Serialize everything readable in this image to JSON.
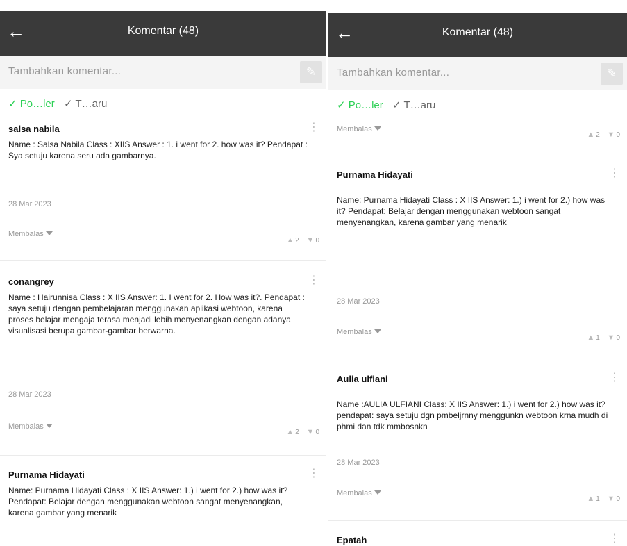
{
  "left": {
    "header": {
      "title": "Komentar (48)"
    },
    "input": {
      "placeholder": "Tambahkan komentar..."
    },
    "sort": {
      "popular": "✓ Po…ler",
      "newest": "✓ T…aru"
    },
    "comments": [
      {
        "author": "salsa nabila",
        "text": "Name : Salsa Nabila Class : XIIS Answer : 1. i went for 2. how was it? Pendapat : Sya setuju karena seru ada gambarnya.",
        "date": "28 Mar 2023",
        "reply": "Membalas",
        "likes": "2",
        "dislikes": "0"
      },
      {
        "author": "conangrey",
        "text": "Name : Hairunnisa Class : X IIS Answer: 1. I went for 2. How was it?. Pendapat : saya setuju dengan pembelajaran menggunakan aplikasi webtoon, karena proses belajar mengaja terasa menjadi lebih menyenangkan dengan adanya visualisasi berupa gambar-gambar berwarna.",
        "date": "28 Mar 2023",
        "reply": "Membalas",
        "likes": "2",
        "dislikes": "0"
      },
      {
        "author": "Purnama Hidayati",
        "text": "Name: Purnama Hidayati Class : X IIS Answer: 1.) i went for 2.) how was it? Pendapat: Belajar dengan menggunakan webtoon sangat menyenangkan, karena gambar yang menarik"
      }
    ]
  },
  "right": {
    "header": {
      "title": "Komentar (48)"
    },
    "input": {
      "placeholder": "Tambahkan komentar..."
    },
    "sort": {
      "popular": "✓ Po…ler",
      "newest": "✓ T…aru"
    },
    "partial": {
      "reply": "Membalas",
      "likes": "2",
      "dislikes": "0"
    },
    "comments": [
      {
        "author": "Purnama Hidayati",
        "text": "Name: Purnama Hidayati Class : X IIS Answer: 1.) i went for 2.) how was it? Pendapat: Belajar dengan menggunakan webtoon sangat menyenangkan, karena gambar yang menarik",
        "date": "28 Mar 2023",
        "reply": "Membalas",
        "likes": "1",
        "dislikes": "0"
      },
      {
        "author": "Aulia ulfiani",
        "text": "Name :AULIA ULFIANI Class: X IIS Answer: 1.) i went for 2.) how was it? pendapat: saya setuju dgn pmbeljrnny menggunkn webtoon krna mudh di phmi dan tdk mmbosnkn",
        "date": "28 Mar 2023",
        "reply": "Membalas",
        "likes": "1",
        "dislikes": "0"
      },
      {
        "author": "Epatah"
      }
    ]
  }
}
